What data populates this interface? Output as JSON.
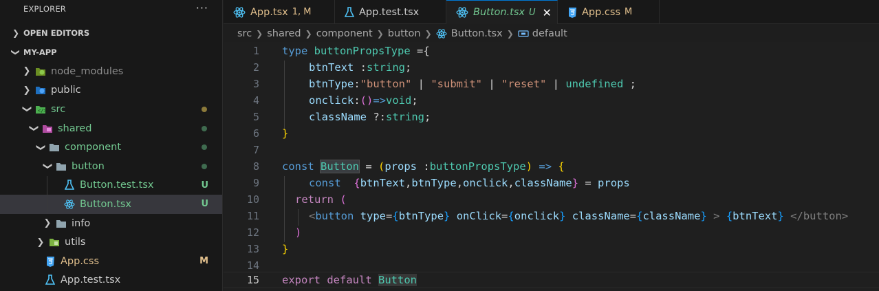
{
  "sidebar": {
    "title": "EXPLORER",
    "more": "···",
    "open_editors": "OPEN EDITORS",
    "project": "MY-APP",
    "items": [
      {
        "label": "node_modules",
        "color": "#8c8c8c"
      },
      {
        "label": "public",
        "color": "#cccccc"
      },
      {
        "label": "src",
        "color": "#73c991"
      },
      {
        "label": "shared",
        "color": "#73c991"
      },
      {
        "label": "component",
        "color": "#73c991"
      },
      {
        "label": "button",
        "color": "#73c991"
      },
      {
        "label": "Button.test.tsx",
        "color": "#73c991",
        "badge": "U"
      },
      {
        "label": "Button.tsx",
        "color": "#73c991",
        "badge": "U"
      },
      {
        "label": "info",
        "color": "#cccccc"
      },
      {
        "label": "utils",
        "color": "#cccccc"
      },
      {
        "label": "App.css",
        "color": "#e2c08d",
        "badge": "M"
      },
      {
        "label": "App.test.tsx",
        "color": "#cccccc"
      }
    ]
  },
  "tabs": [
    {
      "label": "App.tsx",
      "badge": "1, M",
      "color": "#e2c08d",
      "icon": "react-icon"
    },
    {
      "label": "App.test.tsx",
      "badge": "",
      "color": "#cccccc",
      "icon": "flask-icon"
    },
    {
      "label": "Button.tsx",
      "badge": "U",
      "color": "#73c991",
      "icon": "react-icon"
    },
    {
      "label": "App.css",
      "badge": "M",
      "color": "#e2c08d",
      "icon": "css-icon"
    }
  ],
  "close_glyph": "✕",
  "breadcrumb": [
    "src",
    "shared",
    "component",
    "button",
    "Button.tsx",
    "default"
  ],
  "editor": {
    "line_numbers": [
      "1",
      "2",
      "3",
      "4",
      "5",
      "6",
      "7",
      "8",
      "9",
      "10",
      "11",
      "12",
      "13",
      "14",
      "15"
    ],
    "current_line": "15",
    "lines": {
      "l1": {
        "kw": "type",
        "name": "buttonPropsType",
        "rest": " ={"
      },
      "l2": {
        "prop": "btnText",
        "sep": " :",
        "type": "string",
        "end": ";"
      },
      "l3": {
        "prop": "btnType",
        "sep": ":",
        "s1": "\"button\"",
        "p1": " | ",
        "s2": "\"submit\"",
        "p2": " | ",
        "s3": "\"reset\"",
        "p3": " | ",
        "undef": "undefined",
        "end": " ;"
      },
      "l4": {
        "prop": "onclick",
        "sep": ":",
        "paren": "()",
        "arrow": "=>",
        "type": "void",
        "end": ";"
      },
      "l5": {
        "prop": "className",
        "sep": " ?:",
        "type": "string",
        "end": ";"
      },
      "l6": {
        "brace": "}"
      },
      "l8": {
        "kw": "const",
        "name": "Button",
        "eq": " = ",
        "p_open": "(",
        "param": "props",
        "colon": " :",
        "ptype": "buttonPropsType",
        "p_close": ")",
        "arrow": " => ",
        "brace": "{"
      },
      "l9": {
        "kw": "const",
        "open": "{",
        "a": "btnText",
        "b": "btnType",
        "c": "onclick",
        "d": "className",
        "close": "}",
        "eq": " = ",
        "props": "props"
      },
      "l10": {
        "kw": "return",
        "paren": "("
      },
      "l11": {
        "lt": "<",
        "tag": "button",
        "attr1": "type",
        "v1": "btnType",
        "attr2": "onClick",
        "v2": "onclick",
        "attr3": "className",
        "v3": "className",
        "gt": ">",
        "v4": "btnText",
        "close": "</button>"
      },
      "l12": {
        "paren": ")"
      },
      "l13": {
        "brace": "}"
      },
      "l15": {
        "kw1": "export",
        "kw2": "default",
        "name": "Button"
      }
    }
  }
}
